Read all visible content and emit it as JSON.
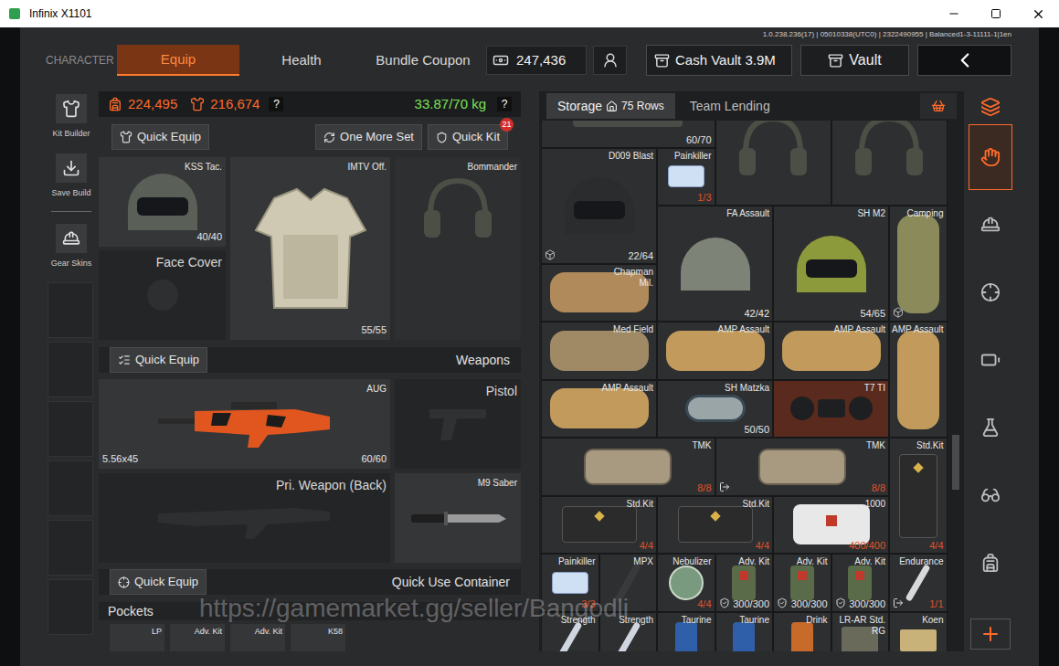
{
  "window": {
    "title": "Infinix X1101"
  },
  "build_info": "1.0.238.236(17) | 05010338(UTC0) | 2322490955 | Balanced1-3-11111-1|1en",
  "nav": {
    "section": "CHARACTER",
    "tabs": [
      {
        "label": "Equip",
        "selected": true
      },
      {
        "label": "Health",
        "selected": false
      },
      {
        "label": "Bundle Coupon",
        "selected": false
      }
    ],
    "currency": "247,436",
    "cash_vault": "Cash Vault 3.9M",
    "vault": "Vault"
  },
  "sidebar": {
    "items": [
      {
        "label": "Kit Builder"
      },
      {
        "label": "Save Build"
      },
      {
        "label": "Gear Skins"
      }
    ]
  },
  "equip": {
    "value_1": "224,495",
    "value_2": "216,674",
    "value_help": "?",
    "weight": "33.87/70 kg",
    "weight_help": "?",
    "quick_equip": "Quick Equip",
    "one_more_set": "One More Set",
    "quick_kit": "Quick Kit",
    "quick_kit_badge": "21",
    "helmet": {
      "name": "KSS Tac.",
      "durability": "40/40"
    },
    "face_cover": {
      "label": "Face Cover"
    },
    "armor": {
      "name": "IMTV Off.",
      "durability": "55/55"
    },
    "headset": {
      "name": "Bommander"
    }
  },
  "weapons": {
    "quick_equip": "Quick Equip",
    "title": "Weapons",
    "primary": {
      "name": "AUG",
      "caliber": "5.56x45",
      "ammo": "60/60"
    },
    "pistol": {
      "label": "Pistol"
    },
    "primary_back": {
      "label": "Pri. Weapon (Back)"
    },
    "melee": {
      "name": "M9 Saber"
    }
  },
  "quick_use": {
    "quick_equip": "Quick Equip",
    "title": "Quick Use Container"
  },
  "pockets": {
    "title": "Pockets",
    "items": [
      "LP",
      "Adv. Kit",
      "Adv. Kit",
      "K58"
    ]
  },
  "storage": {
    "tabs": [
      {
        "label": "Storage",
        "rows": "75 Rows",
        "selected": true
      },
      {
        "label": "Team Lending",
        "selected": false
      }
    ],
    "items": [
      {
        "count": "60/70",
        "count_color": "#e6e6e6",
        "kind": "misc",
        "color": "#4a4c48",
        "highlighted": false,
        "badge": "none"
      },
      {
        "kind": "headset",
        "color": "#4b4f45",
        "highlighted": false,
        "badge": "none"
      },
      {
        "kind": "headset",
        "color": "#4b4f45",
        "highlighted": false,
        "badge": "none"
      },
      {
        "name": "D009 Blast",
        "count": "22/64",
        "count_color": "#e6e6e6",
        "kind": "helmet_visor",
        "color": "#2a2c2e",
        "highlighted": false,
        "badge": "box"
      },
      {
        "name": "Painkiller",
        "count": "1/3",
        "count_color": "#e0522a",
        "kind": "pills",
        "color": "#cfe0f5",
        "highlighted": false,
        "badge": "none"
      },
      {
        "name": "FA Assault",
        "count": "42/42",
        "count_color": "#e6e6e6",
        "kind": "helmet",
        "color": "#7e8377",
        "highlighted": false,
        "badge": "none"
      },
      {
        "name": "SH M2",
        "count": "54/65",
        "count_color": "#e6e6e6",
        "kind": "helmet_visor",
        "color": "#8d9a3c",
        "highlighted": false,
        "badge": "none"
      },
      {
        "name": "Camping",
        "kind": "bag_v",
        "color": "#8a8a5a",
        "highlighted": false,
        "badge": "box"
      },
      {
        "name": "Chapman Mil.",
        "kind": "bag",
        "color": "#b08a5a",
        "highlighted": false,
        "badge": "none"
      },
      {
        "name": "Med Field",
        "kind": "bag",
        "color": "#a08a66",
        "highlighted": false,
        "badge": "none"
      },
      {
        "name": "AMP Assault",
        "kind": "bag",
        "color": "#c29a5c",
        "highlighted": false,
        "badge": "none"
      },
      {
        "name": "AMP Assault",
        "kind": "bag",
        "color": "#c29a5c",
        "highlighted": false,
        "badge": "none"
      },
      {
        "name": "AMP Assault",
        "kind": "bag_v",
        "color": "#c29a5c",
        "highlighted": false,
        "badge": "none"
      },
      {
        "name": "AMP Assault",
        "kind": "bag",
        "color": "#c29a5c",
        "highlighted": false,
        "badge": "none"
      },
      {
        "name": "SH Matzka",
        "count": "50/50",
        "count_color": "#e6e6e6",
        "kind": "goggles",
        "color": "#9aa5a8",
        "highlighted": false,
        "badge": "none"
      },
      {
        "name": "T7 TI",
        "kind": "nvg",
        "color": "#1e1f20",
        "highlighted": true,
        "badge": "none"
      },
      {
        "name": "TMK",
        "count": "8/8",
        "count_color": "#e0522a",
        "kind": "case",
        "color": "#a89a80",
        "highlighted": false,
        "badge": "none"
      },
      {
        "name": "TMK",
        "count": "8/8",
        "count_color": "#e0522a",
        "kind": "case",
        "color": "#a89a80",
        "highlighted": false,
        "badge": "arrow"
      },
      {
        "name": "Std.Kit",
        "count": "4/4",
        "count_color": "#e0522a",
        "kind": "kit_v",
        "color": "#2b2b2b",
        "highlighted": false,
        "badge": "none"
      },
      {
        "name": "Std.Kit",
        "count": "4/4",
        "count_color": "#e0522a",
        "kind": "kit",
        "color": "#2b2b2b",
        "highlighted": false,
        "badge": "none"
      },
      {
        "name": "Std.Kit",
        "count": "4/4",
        "count_color": "#e0522a",
        "kind": "kit",
        "color": "#2b2b2b",
        "highlighted": false,
        "badge": "none"
      },
      {
        "name": "1000",
        "count": "400/400",
        "count_color": "#e0522a",
        "kind": "medkit",
        "color": "#e8e8e8",
        "highlighted": false,
        "badge": "none"
      },
      {
        "name": "Painkiller",
        "count": "3/3",
        "count_color": "#e0522a",
        "kind": "pills",
        "color": "#cfe0f5",
        "highlighted": false,
        "badge": "none"
      },
      {
        "name": "MPX",
        "kind": "strap",
        "color": "#3a3a3a",
        "highlighted": false,
        "badge": "none"
      },
      {
        "name": "Nebulizer",
        "count": "4/4",
        "count_color": "#e0522a",
        "kind": "nebulizer",
        "color": "#7a9a80",
        "highlighted": false,
        "badge": "none"
      },
      {
        "name": "Adv. Kit",
        "count": "300/300",
        "count_color": "#e6e6e6",
        "kind": "adv_kit",
        "color": "#5a6b4a",
        "highlighted": false,
        "badge": "shield"
      },
      {
        "name": "Adv. Kit",
        "count": "300/300",
        "count_color": "#e6e6e6",
        "kind": "adv_kit",
        "color": "#5a6b4a",
        "highlighted": false,
        "badge": "shield"
      },
      {
        "name": "Adv. Kit",
        "count": "300/300",
        "count_color": "#e6e6e6",
        "kind": "adv_kit",
        "color": "#5a6b4a",
        "highlighted": false,
        "badge": "shield"
      },
      {
        "name": "Endurance",
        "count": "1/1",
        "count_color": "#e0522a",
        "kind": "syringe",
        "color": "#d9d9d9",
        "highlighted": false,
        "badge": "arrow"
      },
      {
        "name": "Strength",
        "kind": "syringe",
        "color": "#cfd6e0",
        "highlighted": false,
        "badge": "none"
      },
      {
        "name": "Strength",
        "kind": "syringe",
        "color": "#cfd6e0",
        "highlighted": false,
        "badge": "none"
      },
      {
        "name": "Taurine",
        "kind": "can",
        "color": "#2f5fa8",
        "highlighted": false,
        "badge": "none"
      },
      {
        "name": "Taurine",
        "kind": "can",
        "color": "#2f5fa8",
        "highlighted": false,
        "badge": "none"
      },
      {
        "name": "Drink",
        "kind": "can",
        "color": "#c86a2a",
        "highlighted": false,
        "badge": "none"
      },
      {
        "name": "LR-AR Std. RG",
        "kind": "ammo",
        "color": "#6a6a5a",
        "highlighted": false,
        "badge": "none"
      },
      {
        "name": "Koen",
        "kind": "money",
        "color": "#c9b27a",
        "highlighted": false,
        "badge": "none"
      }
    ]
  },
  "category_tabs": [
    {
      "selected": true
    },
    {
      "selected": false
    },
    {
      "selected": false
    },
    {
      "selected": false
    },
    {
      "selected": false
    },
    {
      "selected": false
    },
    {
      "selected": false
    }
  ],
  "watermark": "https://gamemarket.gg/seller/Bangodli"
}
